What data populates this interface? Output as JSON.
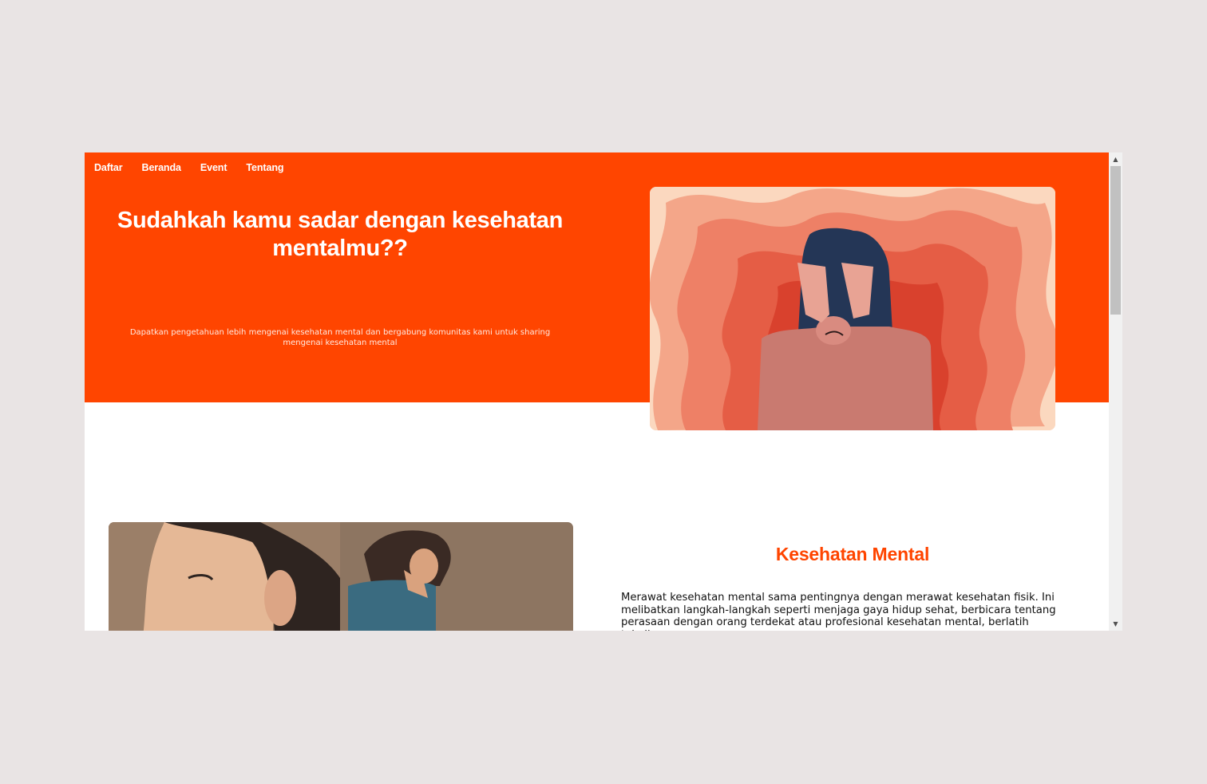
{
  "nav": {
    "items": [
      {
        "label": "Daftar"
      },
      {
        "label": "Beranda"
      },
      {
        "label": "Event"
      },
      {
        "label": "Tentang"
      }
    ]
  },
  "hero": {
    "title": "Sudahkah kamu sadar dengan kesehatan mentalmu??",
    "subtitle": "Dapatkan pengetahuan lebih mengenai kesehatan mental dan bergabung komunitas kami untuk sharing mengenai kesehatan mental"
  },
  "section": {
    "title": "Kesehatan Mental",
    "body": "Merawat kesehatan mental sama pentingnya dengan merawat kesehatan fisik. Ini melibatkan langkah-langkah seperti menjaga gaya hidup sehat, berbicara tentang perasaan dengan orang terdekat atau profesional kesehatan mental, berlatih teknik"
  },
  "colors": {
    "brand": "#ff4500",
    "background": "#e9e4e4"
  },
  "icons": {
    "scroll_up": "scroll-up-arrow-icon",
    "scroll_down": "scroll-down-arrow-icon"
  }
}
